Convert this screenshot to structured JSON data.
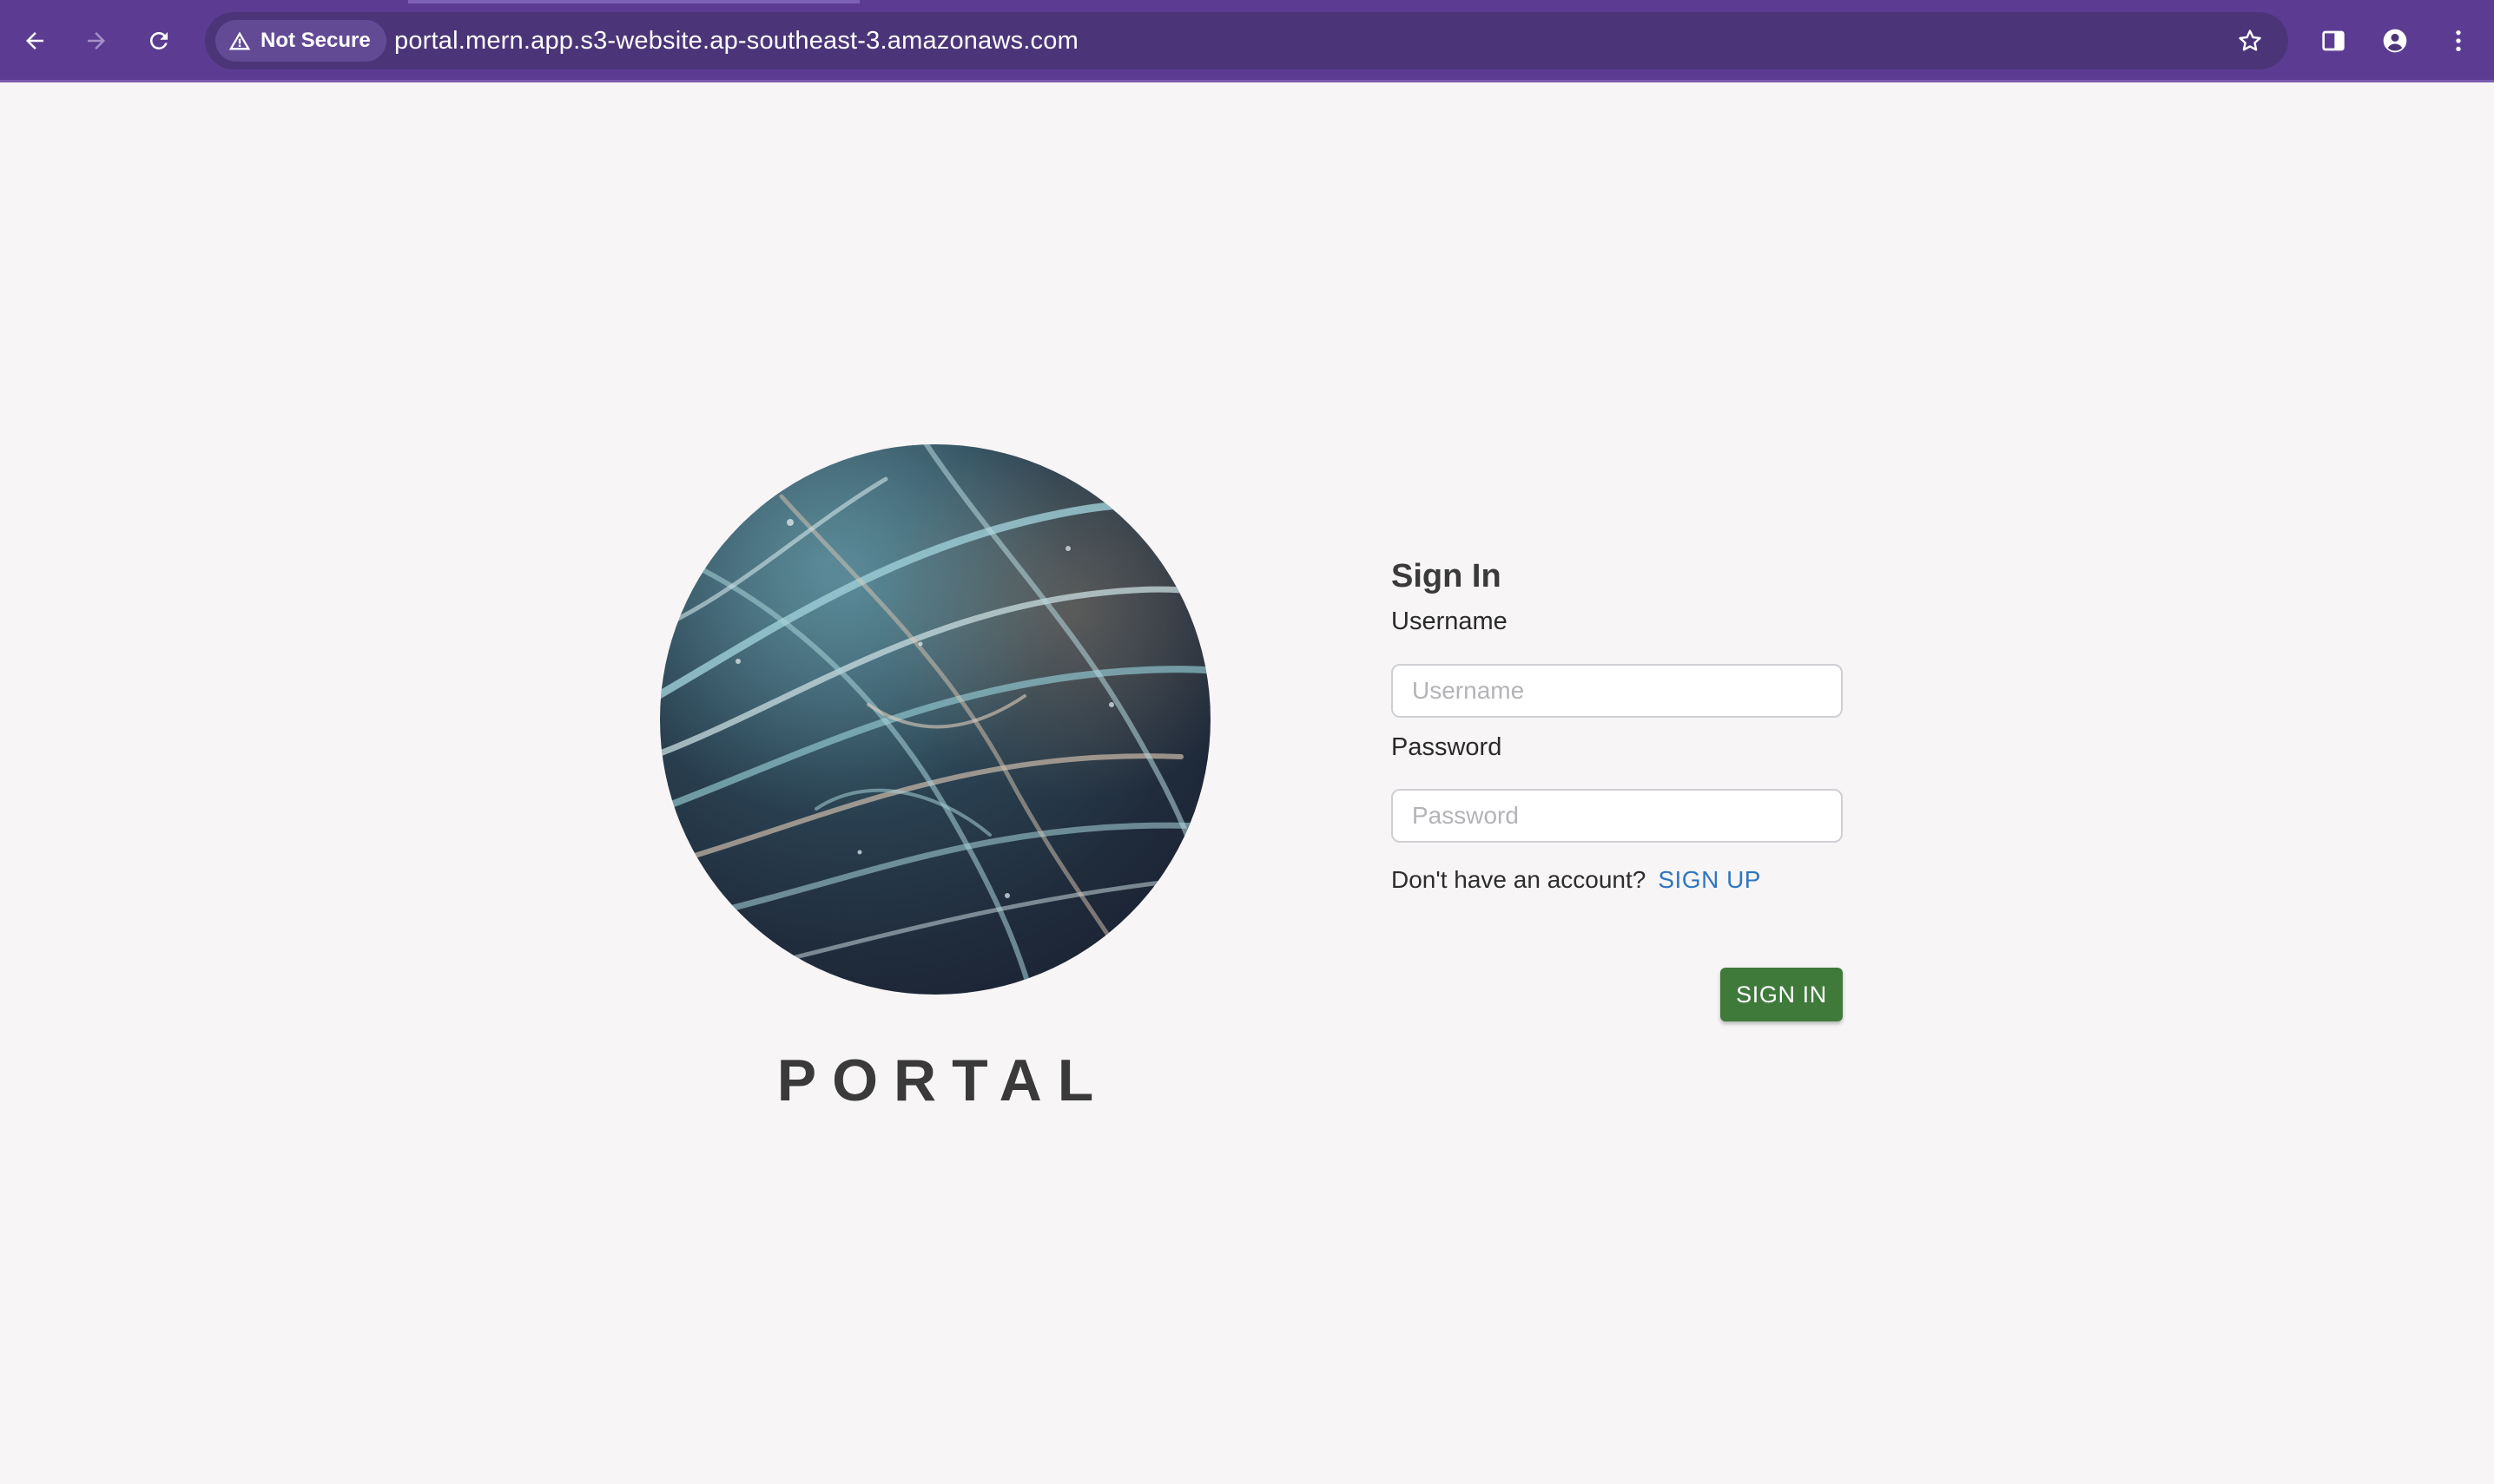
{
  "browser": {
    "security_label": "Not Secure",
    "url": "portal.mern.app.s3-website.ap-southeast-3.amazonaws.com",
    "toolbar_color": "#5c3c92",
    "omnibox_color": "#4b3578"
  },
  "brand": {
    "name": "PORTAL"
  },
  "signin_form": {
    "heading": "Sign In",
    "username_label": "Username",
    "username_placeholder": "Username",
    "password_label": "Password",
    "password_placeholder": "Password",
    "signup_prompt": "Don't have an account?",
    "signup_link": "SIGN UP",
    "submit_label": "SIGN IN",
    "submit_color": "#3f7a3b",
    "link_color": "#2f76c0"
  }
}
